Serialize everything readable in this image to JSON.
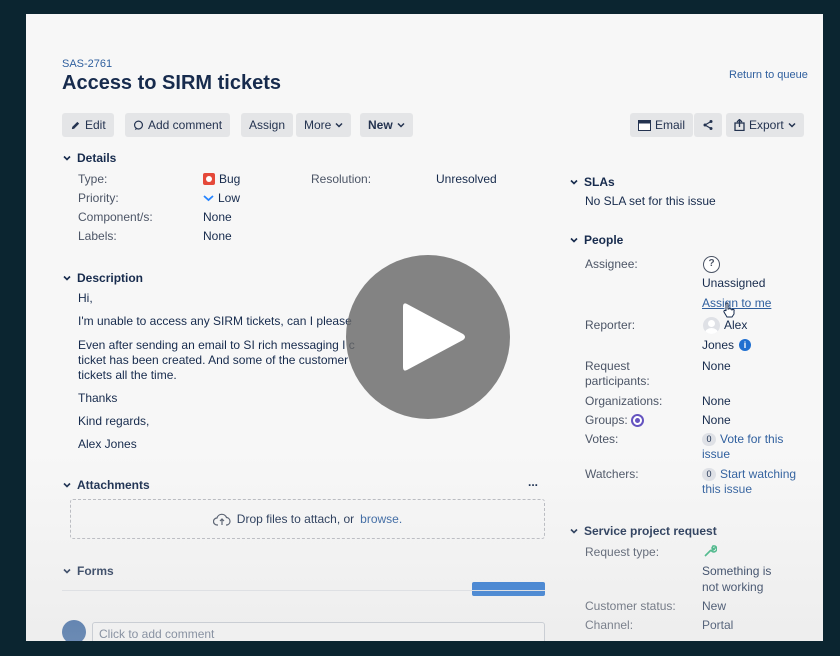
{
  "issue": {
    "key": "SAS-2761",
    "title": "Access to SIRM tickets",
    "return_link": "Return to queue"
  },
  "toolbar": {
    "edit": "Edit",
    "add_comment": "Add comment",
    "assign": "Assign",
    "more": "More",
    "new": "New",
    "email": "Email",
    "export": "Export"
  },
  "details": {
    "heading": "Details",
    "type_label": "Type:",
    "type_value": "Bug",
    "priority_label": "Priority:",
    "priority_value": "Low",
    "components_label": "Component/s:",
    "components_value": "None",
    "labels_label": "Labels:",
    "labels_value": "None",
    "resolution_label": "Resolution:",
    "resolution_value": "Unresolved"
  },
  "description": {
    "heading": "Description",
    "lines": [
      "Hi,",
      "I'm unable to access any SIRM tickets, can I please",
      "Even after sending an email to SI rich messaging I c",
      "ticket has been created. And some of the customer",
      "tickets all the time.",
      "Thanks",
      "Kind regards,",
      "Alex Jones"
    ]
  },
  "attachments": {
    "heading": "Attachments",
    "more": "...",
    "drop_text": "Drop files to attach, or",
    "browse": "browse."
  },
  "forms": {
    "heading": "Forms"
  },
  "comment": {
    "placeholder": "Click to add comment"
  },
  "slas": {
    "heading": "SLAs",
    "text": "No SLA set for this issue"
  },
  "people": {
    "heading": "People",
    "assignee_label": "Assignee:",
    "assignee_value": "Unassigned",
    "assign_to_me": "Assign to me",
    "reporter_label": "Reporter:",
    "reporter_first": "Alex",
    "reporter_last": "Jones",
    "participants_label_1": "Request",
    "participants_label_2": "participants:",
    "participants_value": "None",
    "organizations_label": "Organizations:",
    "organizations_value": "None",
    "groups_label": "Groups:",
    "groups_value": "None",
    "votes_label": "Votes:",
    "votes_count": "0",
    "votes_link_1": "Vote for this",
    "votes_link_2": "issue",
    "watchers_label": "Watchers:",
    "watchers_count": "0",
    "watchers_link_1": "Start watching",
    "watchers_link_2": "this issue"
  },
  "service": {
    "heading": "Service project request",
    "request_type_label": "Request type:",
    "request_type_1": "Something is",
    "request_type_2": "not working",
    "status_label": "Customer status:",
    "status_value": "New",
    "channel_label": "Channel:",
    "channel_value": "Portal"
  },
  "colors": {
    "link": "#2f5f9e",
    "bug": "#e5493a",
    "priority": "#2684ff",
    "info": "#1f6fd0",
    "groups": "#6554c0"
  }
}
